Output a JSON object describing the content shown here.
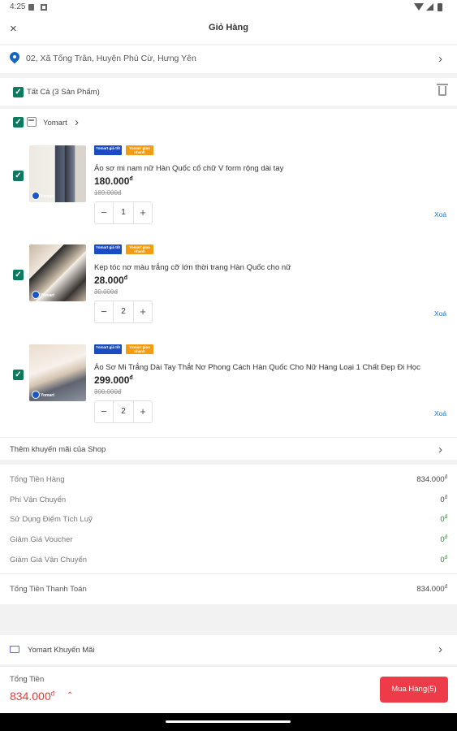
{
  "status_bar": {
    "time": "4:25"
  },
  "header": {
    "title": "Giỏ Hàng",
    "close_icon": "×"
  },
  "address": {
    "text": "02, Xã  Tống Trân, Huyện Phù Cừ, Hưng Yên"
  },
  "select_all": {
    "label": "Tất Cả (3 Sản Phẩm)"
  },
  "shop": {
    "name": "Yomart"
  },
  "items": [
    {
      "name": "Áo sơ mi nam nữ Hàn Quốc cổ chữ V form rộng dài tay",
      "price": "180.000",
      "old_price": "189.000đ",
      "quantity": "1",
      "remove": "Xoá",
      "tag1": "Yomart giá tốt",
      "tag2": "Yomart giao nhanh"
    },
    {
      "name": "Kẹp tóc nơ màu trắng cỡ lớn thời trang Hàn Quốc cho nữ",
      "price": "28.000",
      "old_price": "30.000đ",
      "quantity": "2",
      "remove": "Xoá",
      "tag1": "Yomart giá tốt",
      "tag2": "Yomart giao nhanh"
    },
    {
      "name": "Áo Sơ Mi Trắng Dài Tay Thắt Nơ Phong Cách Hàn Quốc Cho Nữ Hàng Loại 1 Chất Đẹp Đi Học",
      "price": "299.000",
      "old_price": "300.000đ",
      "quantity": "2",
      "remove": "Xoá",
      "tag1": "Yomart giá tốt",
      "tag2": "Yomart giao nhanh"
    }
  ],
  "currency_symbol": "đ",
  "shop_promo": {
    "label": "Thêm khuyến mãi của Shop"
  },
  "summary": {
    "rows": [
      {
        "label": "Tổng Tiền Hàng",
        "value": "834.000"
      },
      {
        "label": "Phí Vận Chuyển",
        "value": "0"
      },
      {
        "label": "Sử Dụng Điểm Tích Luỹ",
        "value": "0"
      },
      {
        "label": "Giảm Giá Voucher",
        "value": "0"
      },
      {
        "label": "Giảm Giá Vận Chuyển",
        "value": "0"
      }
    ],
    "grand": {
      "label": "Tổng Tiền Thanh Toán",
      "value": "834.000"
    }
  },
  "yomart_promo": {
    "label": "Yomart Khuyến Mãi"
  },
  "footer": {
    "total_label": "Tổng Tiền",
    "total": "834.000",
    "buy_label": "Mua Hàng(5)"
  },
  "colors": {
    "accent_green": "#0d7a5f",
    "buy_red": "#ee3b4a",
    "link_blue": "#1976d2"
  }
}
